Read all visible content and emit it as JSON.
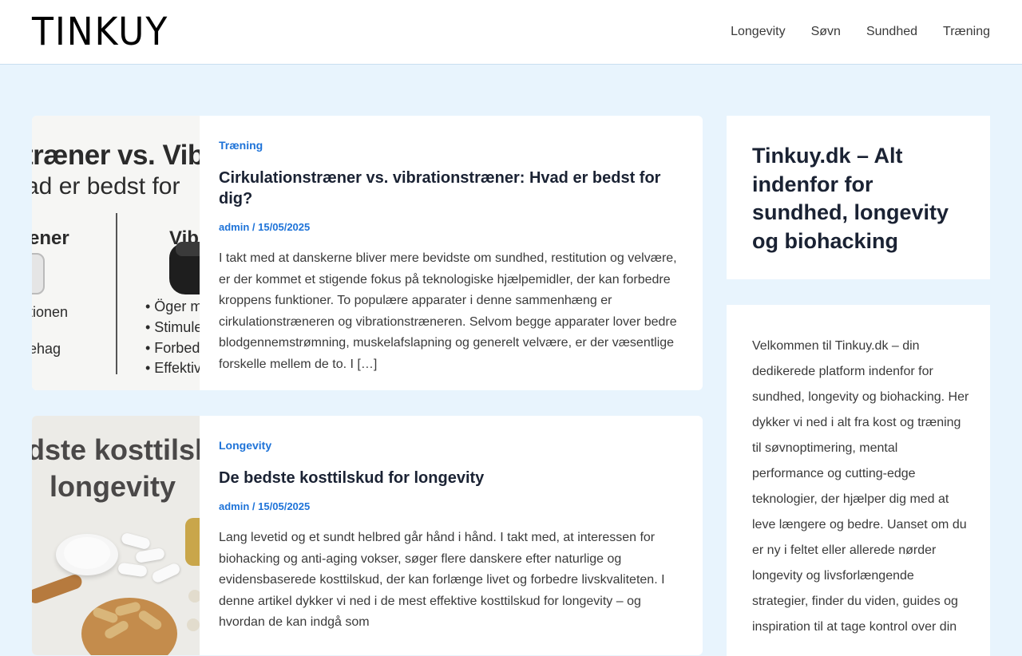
{
  "header": {
    "logo": "TINKUY",
    "nav": [
      "Longevity",
      "Søvn",
      "Sundhed",
      "Træning"
    ]
  },
  "posts": [
    {
      "category": "Træning",
      "title": "Cirkulationstræner vs. vibrationstræner: Hvad er bedst for dig?",
      "author": "admin",
      "separator": "/",
      "date": "15/05/2025",
      "excerpt": "I takt med at danskerne bliver mere bevidste om sundhed, restitution og velvære, er der kommet et stigende fokus på teknologiske hjælpemidler, der kan forbedre kroppens funktioner. To populære apparater i denne sammenhæng er cirkulationstræneren og vibrationstræneren. Selvom begge apparater lover bedre blodgennemstrømning, muskelafslapning og generelt velvære, er der væsentlige forskelle mellem de to. I […]",
      "thumb": {
        "line1": "træner vs. Vib",
        "line2": "ad er bedst for",
        "label_left": "ener",
        "label_right": "Vib",
        "left_items": [
          "tionen",
          "ehag"
        ],
        "right_items": [
          "• Öger mu",
          "• Stimuler",
          "• Forbedr",
          "• Effektiv"
        ]
      }
    },
    {
      "category": "Longevity",
      "title": "De bedste kosttilskud for longevity",
      "author": "admin",
      "separator": "/",
      "date": "15/05/2025",
      "excerpt": "Lang levetid og et sundt helbred går hånd i hånd. I takt med, at interessen for biohacking og anti-aging vokser, søger flere danskere efter naturlige og evidensbaserede kosttilskud, der kan forlænge livet og forbedre livskvaliteten. I denne artikel dykker vi ned i de mest effektive kosttilskud for longevity – og hvordan de kan indgå som",
      "thumb": {
        "line1": "dste kosttilsk",
        "line2": "longevity"
      }
    }
  ],
  "sidebar": {
    "title": "Tinkuy.dk – Alt indenfor for sundhed, longevity og biohacking",
    "text": "Velkommen til Tinkuy.dk – din dedikerede platform indenfor for sundhed, longevity og biohacking. Her dykker vi ned i alt fra kost og træning til søvnoptimering, mental performance og cutting-edge teknologier, der hjælper dig med at leve længere og bedre. Uanset om du er ny i feltet eller allerede nørder longevity og livsforlængende strategier, finder du viden, guides og inspiration til at tage kontrol over din"
  }
}
